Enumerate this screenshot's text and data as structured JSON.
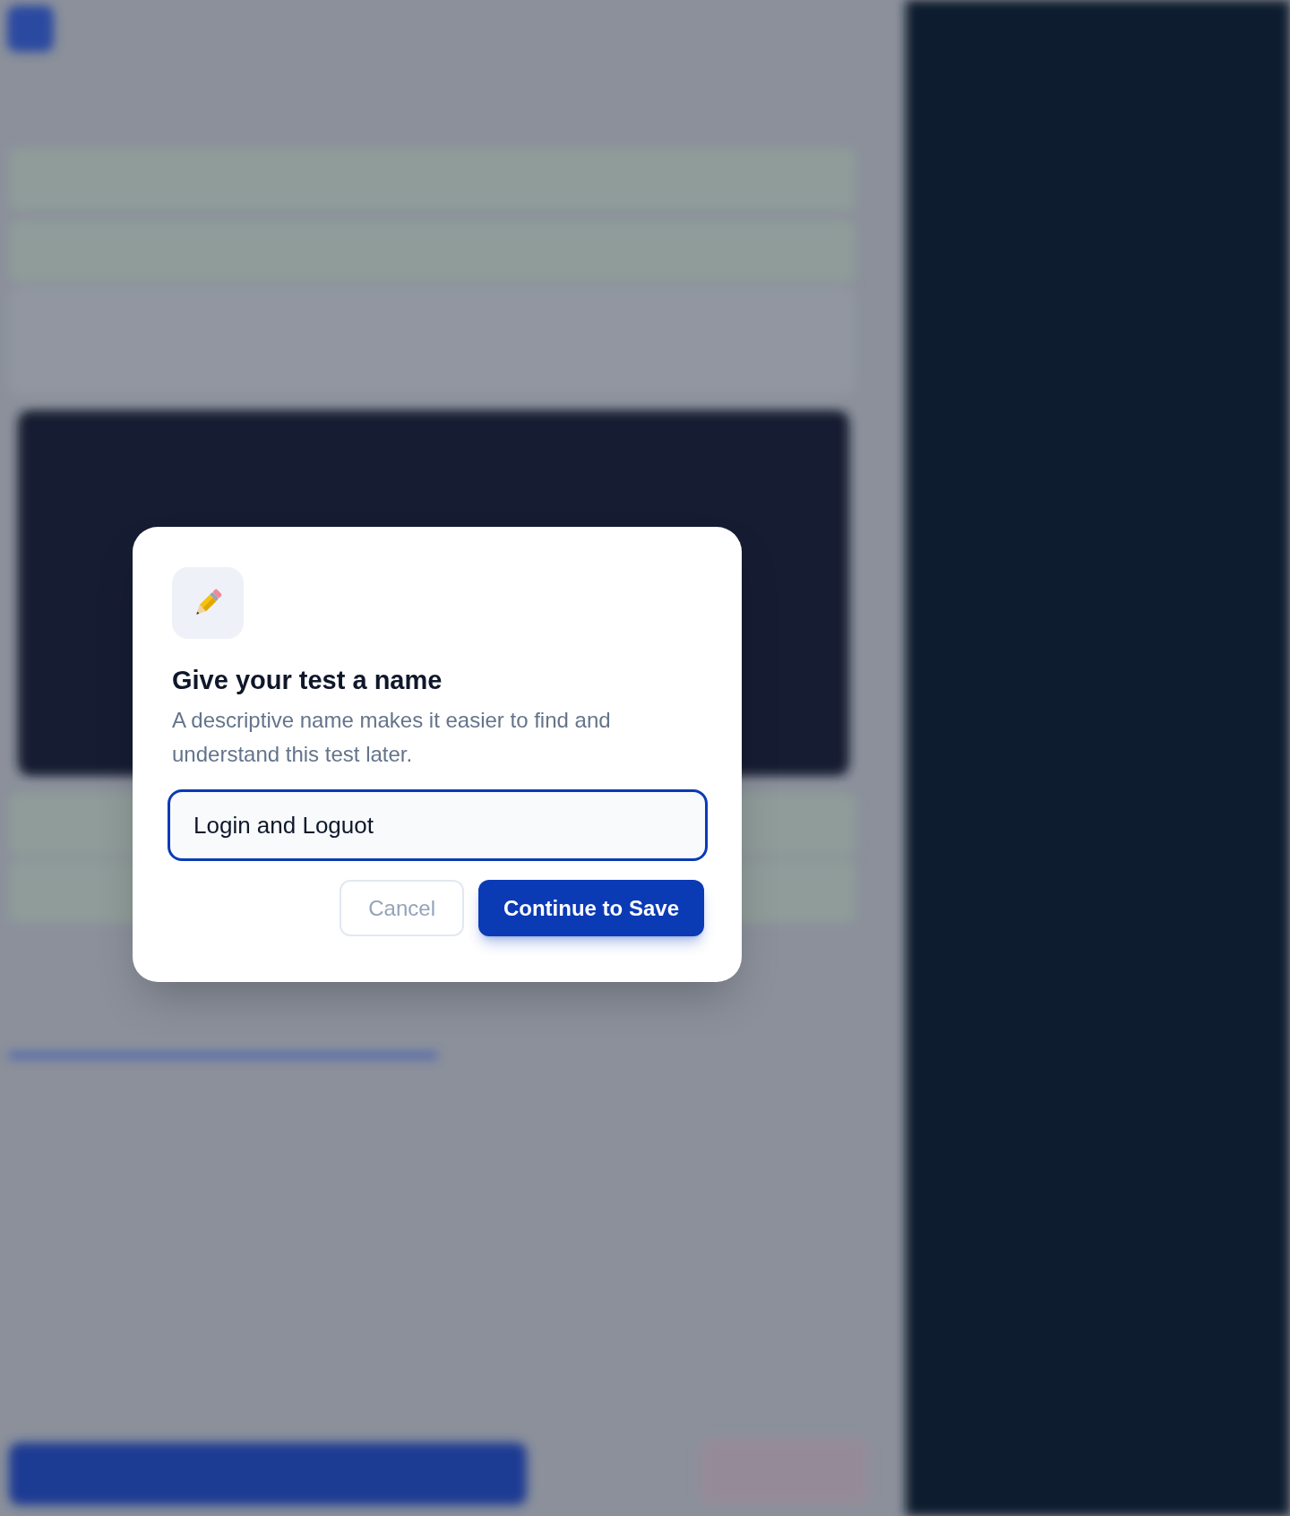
{
  "dialog": {
    "title": "Give your test a name",
    "description": "A descriptive name makes it easier to find and understand this test later.",
    "name_field": {
      "value": "Login and Loguot"
    },
    "buttons": [
      {
        "label": "Cancel",
        "kind": "secondary"
      },
      {
        "label": "Continue to Save",
        "kind": "primary"
      }
    ]
  }
}
